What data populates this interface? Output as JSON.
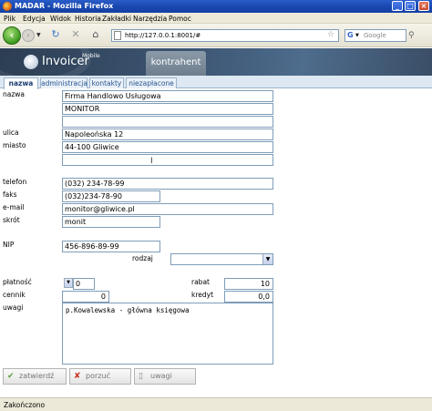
{
  "window": {
    "title": "MADAR - Mozilla Firefox"
  },
  "menu": [
    "Plik",
    "Edycja",
    "Widok",
    "Historia",
    "Zakładki",
    "Narzędzia",
    "Pomoc"
  ],
  "nav": {
    "url": "http://127.0.0.1:8001/#",
    "search_placeholder": "Google",
    "search_engine_glyph": "G"
  },
  "app": {
    "logo": "Invoicer",
    "logo_sup": "Mobile",
    "section_tab": "kontrahent"
  },
  "subtabs": [
    "nazwa",
    "administracja",
    "kontakty",
    "niezapłacone"
  ],
  "labels": {
    "nazwa": "nazwa",
    "ulica": "ulica",
    "miasto": "miasto",
    "telefon": "telefon",
    "faks": "faks",
    "email": "e-mail",
    "skrot": "skrót",
    "nip": "NIP",
    "rodzaj": "rodzaj",
    "platnosc": "płatność",
    "rabat": "rabat",
    "cennik": "cennik",
    "kredyt": "kredyt",
    "uwagi": "uwagi"
  },
  "fields": {
    "nazwa1": "Firma Handlowo Usługowa",
    "nazwa2": "MONITOR",
    "nazwa3": "",
    "ulica": "Napoleońska 12",
    "miasto": "44-100 Gliwice",
    "miasto2": "",
    "telefon": "(032) 234-78-99",
    "faks": "(032)234-78-90",
    "email": "monitor@gliwice.pl",
    "skrot": "monit",
    "nip": "456-896-89-99",
    "rodzaj": "",
    "platnosc": "0",
    "rabat": "10",
    "cennik": "0",
    "kredyt": "0,0",
    "uwagi": "p.Kowalewska - główna księgowa"
  },
  "buttons": {
    "save": "zatwierdź",
    "cancel": "porzuć",
    "notes": "uwagi"
  },
  "status": "Zakończono",
  "colors": {
    "accent": "#2a5590",
    "field_border": "#7f9db9",
    "header_bg": "#3d5674"
  }
}
